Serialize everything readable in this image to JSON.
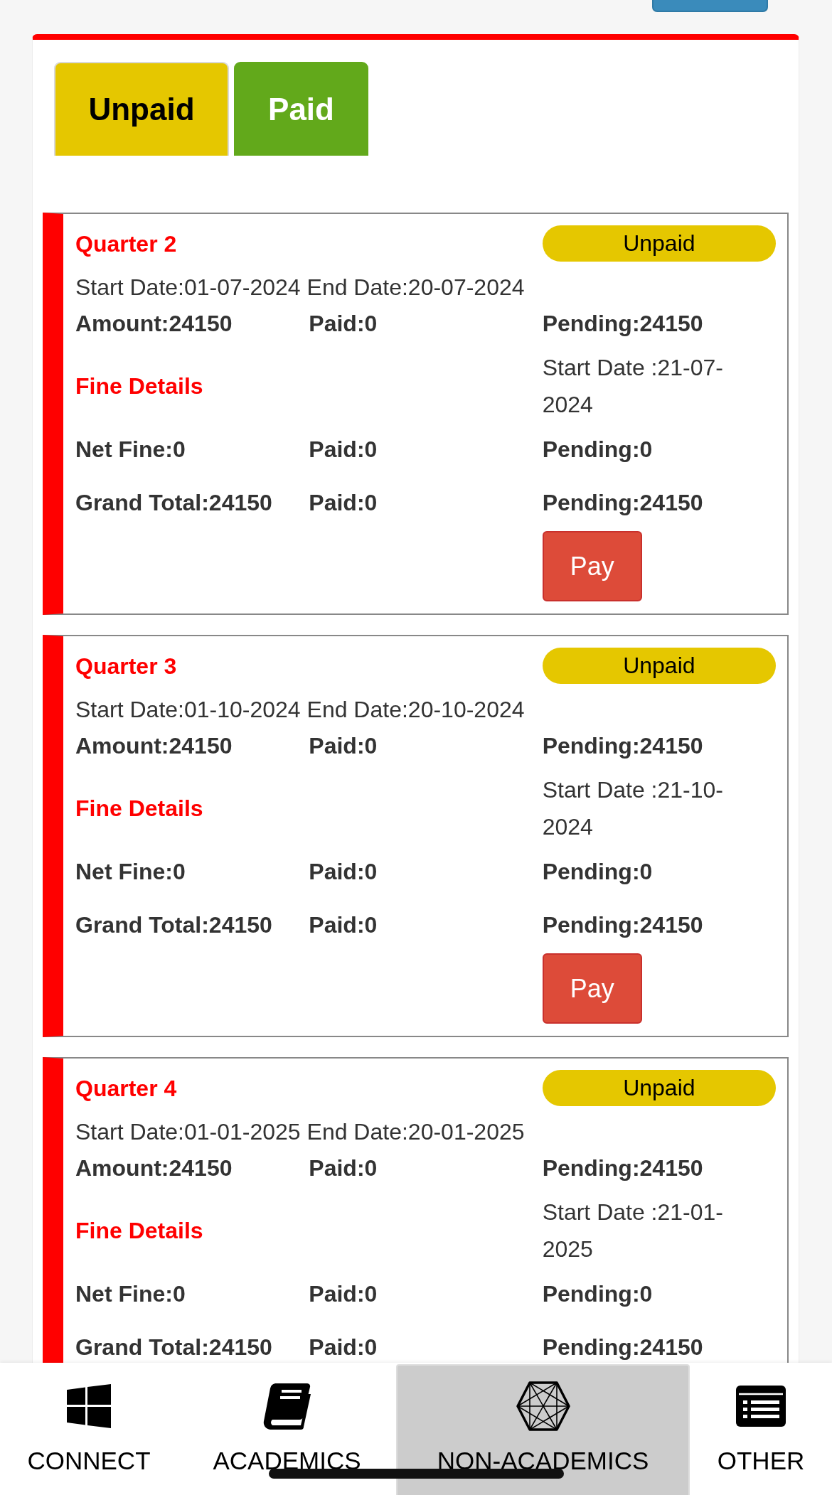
{
  "tabs": [
    {
      "label": "Unpaid",
      "kind": "unpaid",
      "selected": true
    },
    {
      "label": "Paid",
      "kind": "paid",
      "selected": false
    }
  ],
  "quarters": [
    {
      "title": "Quarter 2",
      "status": "Unpaid",
      "dates": "Start Date:01-07-2024 End Date:20-07-2024",
      "amount": "Amount:24150",
      "paid": "Paid:0",
      "pending": "Pending:24150",
      "fine_heading": "Fine Details",
      "fine_start": "Start Date :21-07-2024",
      "net_fine": "Net Fine:0",
      "fine_paid": "Paid:0",
      "fine_pending": "Pending:0",
      "grand_total": "Grand Total:24150",
      "total_paid": "Paid:0",
      "total_pending": "Pending:24150",
      "pay_button": "Pay"
    },
    {
      "title": "Quarter 3",
      "status": "Unpaid",
      "dates": "Start Date:01-10-2024 End Date:20-10-2024",
      "amount": "Amount:24150",
      "paid": "Paid:0",
      "pending": "Pending:24150",
      "fine_heading": "Fine Details",
      "fine_start": "Start Date :21-10-2024",
      "net_fine": "Net Fine:0",
      "fine_paid": "Paid:0",
      "fine_pending": "Pending:0",
      "grand_total": "Grand Total:24150",
      "total_paid": "Paid:0",
      "total_pending": "Pending:24150",
      "pay_button": "Pay"
    },
    {
      "title": "Quarter 4",
      "status": "Unpaid",
      "dates": "Start Date:01-01-2025 End Date:20-01-2025",
      "amount": "Amount:24150",
      "paid": "Paid:0",
      "pending": "Pending:24150",
      "fine_heading": "Fine Details",
      "fine_start": "Start Date :21-01-2025",
      "net_fine": "Net Fine:0",
      "fine_paid": "Paid:0",
      "fine_pending": "Pending:0",
      "grand_total": "Grand Total:24150",
      "total_paid": "Paid:0",
      "total_pending": "Pending:24150"
    }
  ],
  "bottom_nav": [
    {
      "label": "CONNECT",
      "selected": false
    },
    {
      "label": "ACADEMICS",
      "selected": false
    },
    {
      "label": "NON-ACADEMICS",
      "selected": true
    },
    {
      "label": "OTHER",
      "selected": false
    }
  ]
}
